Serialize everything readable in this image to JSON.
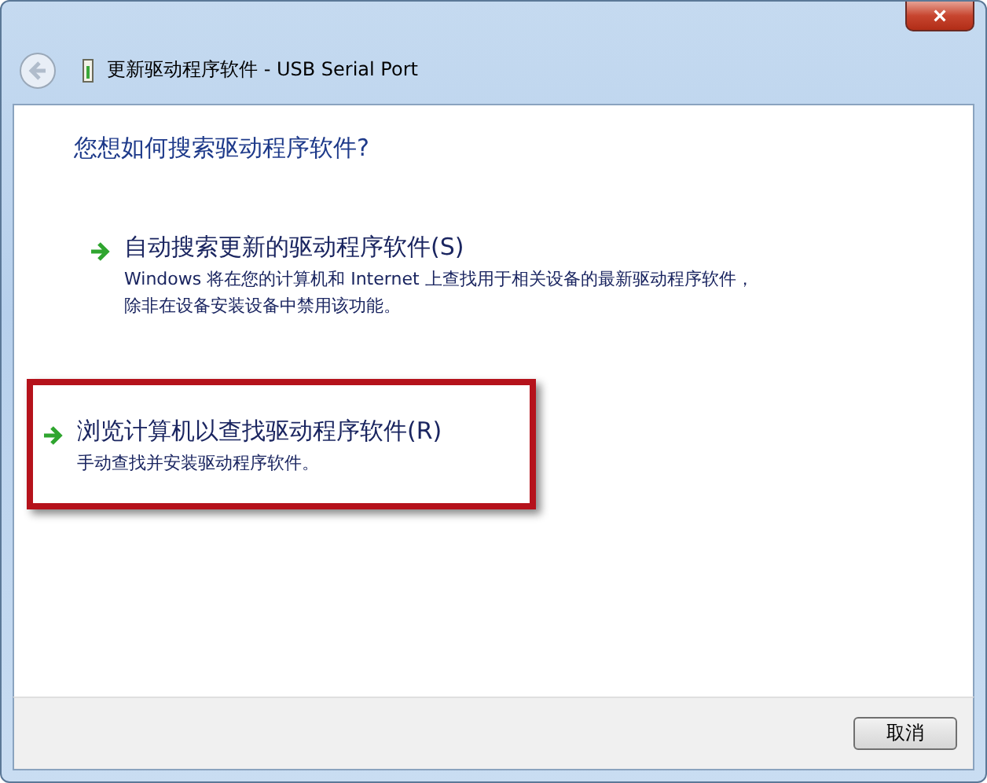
{
  "window": {
    "title": "更新驱动程序软件 - USB Serial Port",
    "close": "×"
  },
  "heading": "您想如何搜索驱动程序软件?",
  "options": [
    {
      "title": "自动搜索更新的驱动程序软件(S)",
      "description": "Windows 将在您的计算机和 Internet 上查找用于相关设备的最新驱动程序软件，除非在设备安装设备中禁用该功能。",
      "highlighted": false
    },
    {
      "title": "浏览计算机以查找驱动程序软件(R)",
      "description": "手动查找并安装驱动程序软件。",
      "highlighted": true
    }
  ],
  "buttons": [
    "取消"
  ]
}
